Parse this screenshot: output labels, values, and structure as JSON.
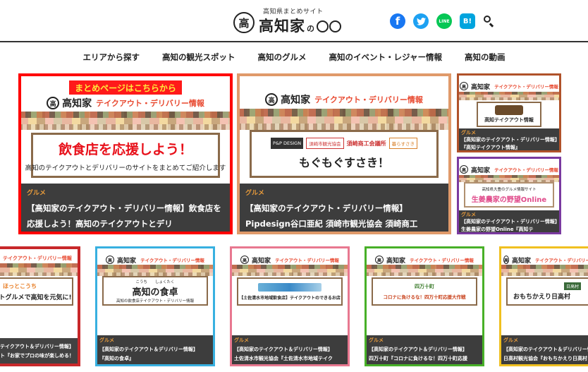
{
  "header": {
    "tagline": "高知県まとめサイト",
    "logo_mark": "高",
    "logo_main": "高知家",
    "logo_no": "の",
    "social": [
      {
        "name": "facebook-icon",
        "glyph": "f",
        "color": "#1877f2"
      },
      {
        "name": "twitter-icon",
        "glyph": "🐦",
        "color": "#1da1f2"
      },
      {
        "name": "line-icon",
        "glyph": "LINE",
        "color": "#06c755"
      },
      {
        "name": "hatena-bookmark-icon",
        "glyph": "B!",
        "color": "#00a4de"
      }
    ],
    "search_icon": "search-icon"
  },
  "nav": {
    "items": [
      "エリアから探す",
      "高知の観光スポット",
      "高知のグルメ",
      "高知のイベント・レジャー情報",
      "高知の動画"
    ]
  },
  "banner": {
    "brand": "高知家",
    "tag": "テイクアウト・デリバリー情報",
    "tag_short": "テイクアウト・デリバリー情報"
  },
  "featured": [
    {
      "border_color": "#ff0000",
      "ribbon": "まとめページはこちらから",
      "headline": "飲食店を応援しよう！",
      "subline": "高知のテイクアウトとデリバリーのサイトをまとめてご紹介します",
      "category": "グルメ",
      "title": "【高知家のテイクアウト・デリバリー情報】飲食店を応援しよう！高知のテイクアウトとデリ"
    },
    {
      "border_color": "#e09a6a",
      "logos": [
        "P&P DESIGN",
        "須崎市観光協会",
        "須崎商工会議所",
        "暮らすさき"
      ],
      "headline": "もぐもぐすさき！",
      "category": "グルメ",
      "title": "【高知家のテイクアウト・デリバリー情報】Pipdesign谷口亜紀 須崎市観光協会 須崎商工"
    }
  ],
  "side": [
    {
      "border_color": "#b0522a",
      "headline": "高知テイクアウト情報",
      "category": "グルメ",
      "title": "【高知家のテイクアウト・デリバリー情報】『高知テイクアウト情報』"
    },
    {
      "border_color": "#7a3aa0",
      "small": "高知県大豊のグルメ情報サイト",
      "headline": "生姜農家の野望Online",
      "category": "グルメ",
      "title": "【高知家のテイクアウト・デリバリー情報】生姜農家の野望Online『高知テ"
    }
  ],
  "bottom": [
    {
      "border_color": "#c8282a",
      "headline": "トグルメで高知を元気に!",
      "logo": "ほっとこうち",
      "category": "",
      "title_1": "テイクアウト＆デリバリー情報】",
      "title_2": "ト『お家でプロの味が楽しめる！"
    },
    {
      "border_color": "#38b0e0",
      "ruby": "こうち　　しょくたく",
      "headline": "高知の食卓",
      "subline": "高知の飲食店テイクアウト・デリバリー情報",
      "category": "グルメ",
      "title_1": "【高知家のテイクアウト＆デリバリー情報】",
      "title_2": "『高知の食卓』"
    },
    {
      "border_color": "#e87890",
      "headline": "【土佐清水市地域飲食店】テイクアウトのできるお店",
      "category": "グルメ",
      "title_1": "【高知家のテイクアウト＆デリバリー情報】",
      "title_2": "土佐清水市観光協会『土佐清水市地域テイク"
    },
    {
      "border_color": "#48b028",
      "logo": "四万十町",
      "headline": "コロナに負けるな！四万十町応援大作戦",
      "category": "グルメ",
      "title_1": "【高知家のテイクアウト＆デリバリー情報】",
      "title_2": "四万十町『コロナに負けるな！四万十町応援"
    },
    {
      "border_color": "#f0c020",
      "logo": "日高村",
      "headline": "おもちかえり日高村",
      "category": "グルメ",
      "title_1": "【高知家のテイクアウト＆デリバリー情報】",
      "title_2": "日高村観光協会『おもちかえり日高村"
    }
  ]
}
